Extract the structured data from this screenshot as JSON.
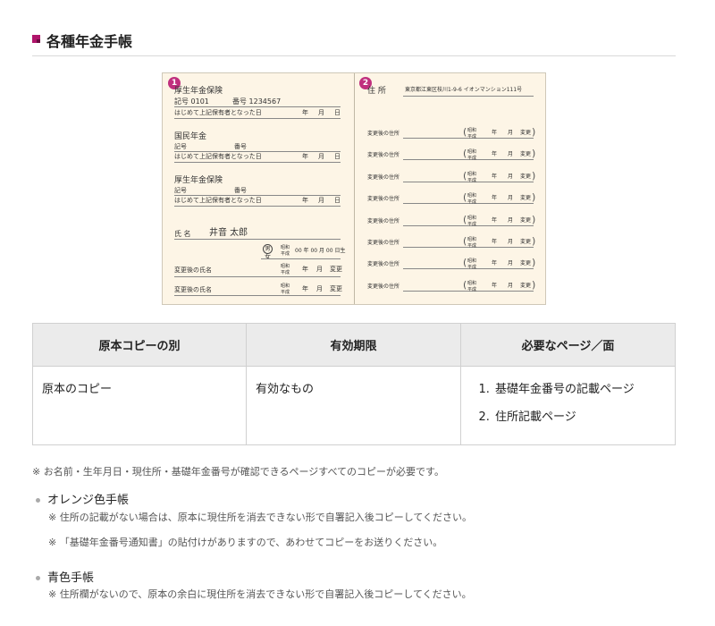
{
  "section": {
    "title": "各種年金手帳"
  },
  "booklet": {
    "badge1": "1",
    "badge2": "2",
    "left": {
      "pension1_title": "厚生年金保険",
      "pension1_symbol": "記号 0101",
      "pension1_number": "番号 1234567",
      "first_insured_label": "はじめて上記保有者となった日",
      "ymd_year": "年",
      "ymd_month": "月",
      "ymd_day": "日",
      "pension2_title": "国民年金",
      "pension2_symbol": "記号",
      "pension2_number": "番号",
      "pension3_title": "厚生年金保険",
      "pension3_symbol": "記号",
      "pension3_number": "番号",
      "name_label": "氏 名",
      "name_value": "井音 太郎",
      "gender_male": "男",
      "gender_female": "女",
      "era_showa": "昭和",
      "era_heisei": "平成",
      "birthdate": "00 年 00 月 00 日生",
      "changed_name_label": "変更後の氏名",
      "change_label": "変更"
    },
    "right": {
      "address_label": "住 所",
      "address_value": "東京都江東区枝川1-9-6 イオンマンション111号",
      "changed_address_label": "変更後の住所",
      "era_showa": "昭和",
      "era_heisei": "平成",
      "year": "年",
      "month": "月",
      "change": "変更"
    }
  },
  "table": {
    "headers": [
      "原本コピーの別",
      "有効期限",
      "必要なページ／面"
    ],
    "row": {
      "copy_type": "原本のコピー",
      "validity": "有効なもの",
      "pages": [
        "基礎年金番号の記載ページ",
        "住所記載ページ"
      ]
    }
  },
  "notes": {
    "general": "※ お名前・生年月日・現住所・基礎年金番号が確認できるページすべてのコピーが必要です。",
    "orange_title": "オレンジ色手帳",
    "orange_note1": "※ 住所の記載がない場合は、原本に現住所を消去できない形で自署記入後コピーしてください。",
    "orange_note2": "※ 「基礎年金番号通知書」の貼付けがありますので、あわせてコピーをお送りください。",
    "blue_title": "青色手帳",
    "blue_note1": "※ 住所欄がないので、原本の余白に現住所を消去できない形で自署記入後コピーしてください。"
  }
}
